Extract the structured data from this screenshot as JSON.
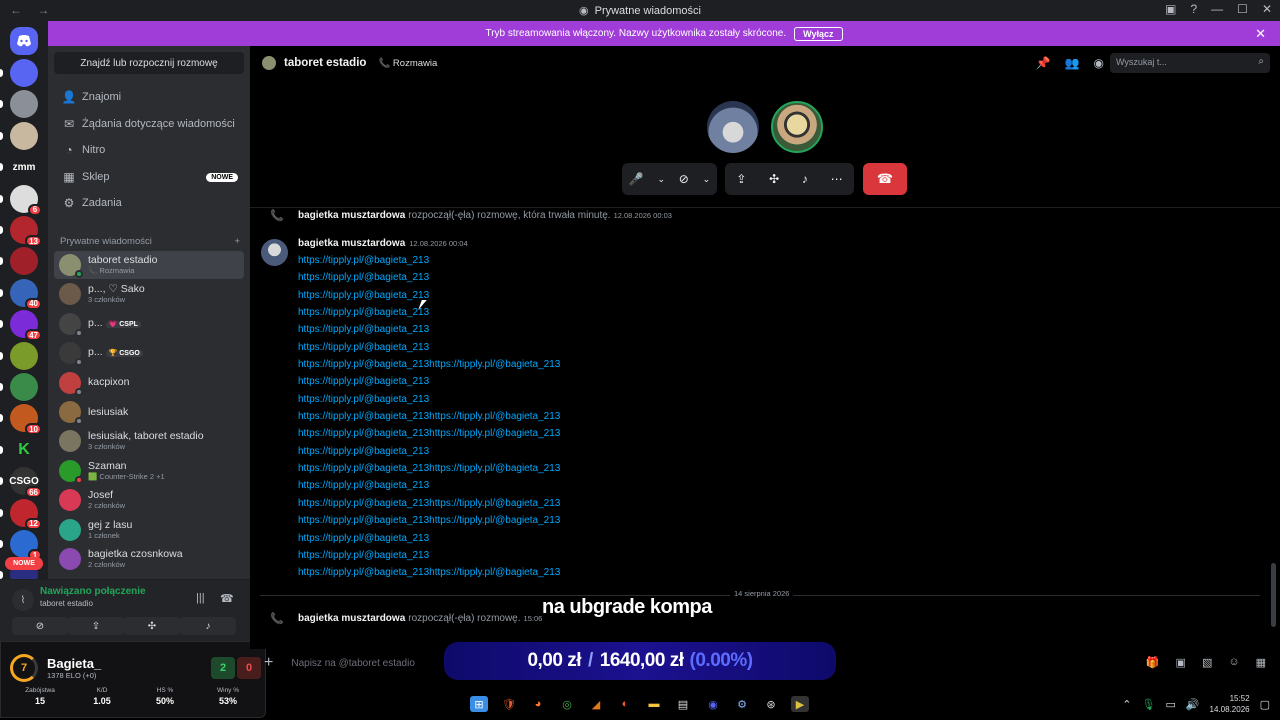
{
  "window": {
    "title": "Prywatne wiadomości",
    "nav_icons": "back-forward-icon",
    "controls": [
      "inbox-icon",
      "help-icon",
      "minimize-icon",
      "maximize-icon",
      "close-icon"
    ]
  },
  "banner": {
    "text": "Tryb streamowania włączony. Nazwy użytkownika zostały skrócone.",
    "button": "Wyłącz"
  },
  "guilds": [
    {
      "abbr": "",
      "color": "#5865f2",
      "badge": ""
    },
    {
      "abbr": "",
      "color": "#8a8f98",
      "badge": ""
    },
    {
      "abbr": "",
      "color": "#c9b8a0",
      "badge": ""
    },
    {
      "abbr": "zmm",
      "color": "#1e1f22",
      "badge": ""
    },
    {
      "abbr": "",
      "color": "#ddd",
      "badge": "6"
    },
    {
      "abbr": "",
      "color": "#b3262d",
      "badge": "13"
    },
    {
      "abbr": "",
      "color": "#a0202a",
      "badge": ""
    },
    {
      "abbr": "",
      "color": "#3564b8",
      "badge": "40"
    },
    {
      "abbr": "",
      "color": "#7c2bd9",
      "badge": "47"
    },
    {
      "abbr": "",
      "color": "#7a9a2a",
      "badge": ""
    },
    {
      "abbr": "",
      "color": "#3a8a4a",
      "badge": ""
    },
    {
      "abbr": "",
      "color": "#c25a20",
      "badge": "10"
    },
    {
      "abbr": "K",
      "color": "#1e1f22",
      "badge": ""
    },
    {
      "abbr": "CSGO",
      "color": "#333",
      "badge": "66"
    },
    {
      "abbr": "",
      "color": "#c0262d",
      "badge": "12"
    },
    {
      "abbr": "",
      "color": "#2b6ad0",
      "badge": "1"
    },
    {
      "abbr": "",
      "color": "#2a2d80",
      "badge": ""
    }
  ],
  "guild_new": "NOWE",
  "sidebar": {
    "search_button": "Znajdź lub rozpocznij rozmowę",
    "nav": [
      {
        "label": "Znajomi",
        "icon": "friends-icon"
      },
      {
        "label": "Żądania dotyczące wiadomości",
        "icon": "mail-icon"
      },
      {
        "label": "Nitro",
        "icon": "nitro-icon"
      },
      {
        "label": "Sklep",
        "icon": "shop-icon",
        "badge": "NOWE"
      },
      {
        "label": "Zadania",
        "icon": "quests-icon"
      }
    ],
    "dm_header": "Prywatne wiadomości",
    "dms": [
      {
        "name": "taboret estadio",
        "sub": "📞 Rozmawia",
        "color": "#8a8f70",
        "status": "#23a55a",
        "tag": ""
      },
      {
        "name": "p..., ♡ Sako",
        "sub": "3 członków",
        "color": "#6b5a4a",
        "status": "",
        "tag": ""
      },
      {
        "name": "p...",
        "sub": "",
        "color": "#444",
        "status": "#80848e",
        "tag": "💗 CSPL"
      },
      {
        "name": "p...",
        "sub": "",
        "color": "#3a3a3a",
        "status": "#80848e",
        "tag": "🏆 CSGO"
      },
      {
        "name": "kacpixon",
        "sub": "",
        "color": "#c04040",
        "status": "#80848e",
        "tag": ""
      },
      {
        "name": "lesiusiak",
        "sub": "",
        "color": "#8a6a40",
        "status": "#80848e",
        "tag": ""
      },
      {
        "name": "lesiusiak, taboret estadio",
        "sub": "3 członków",
        "color": "#7a7560",
        "status": "",
        "tag": ""
      },
      {
        "name": "Szaman",
        "sub": "🟩 Counter-Strike 2 +1",
        "color": "#2a9a2a",
        "status": "#f23f43",
        "tag": ""
      },
      {
        "name": "Josef",
        "sub": "2 członków",
        "color": "#d83a55",
        "status": "",
        "tag": ""
      },
      {
        "name": "gej z lasu",
        "sub": "1 członek",
        "color": "#2aa58a",
        "status": "",
        "tag": ""
      },
      {
        "name": "bagietka czosnkowa",
        "sub": "2 członków",
        "color": "#8a4ab0",
        "status": "",
        "tag": ""
      }
    ]
  },
  "voice": {
    "status": "Nawiązano połączenie",
    "channel": "taboret estadio"
  },
  "elo": {
    "level": "7",
    "nick": "Bagieta_",
    "elo": "1378 ELO (+0)",
    "wins": "2",
    "losses": "0",
    "stats": [
      {
        "label": "Zabójstwa",
        "value": "15"
      },
      {
        "label": "K/D",
        "value": "1.05"
      },
      {
        "label": "HS %",
        "value": "50%"
      },
      {
        "label": "Winy %",
        "value": "53%"
      }
    ]
  },
  "header": {
    "title": "taboret estadio",
    "talking": "Rozmawia",
    "search_placeholder": "Wyszukaj t..."
  },
  "chat": {
    "call1": {
      "author": "bagietka musztardowa",
      "text": "rozpoczął(-ęła) rozmowę, która trwała minutę.",
      "time": "12.08.2026 00:03"
    },
    "msg": {
      "author": "bagietka musztardowa",
      "time": "12.08.2026 00:04",
      "links": [
        "https://tipply.pl/@bagieta_213",
        "https://tipply.pl/@bagieta_213",
        "https://tipply.pl/@bagieta_213",
        "https://tipply.pl/@bagieta_213",
        "https://tipply.pl/@bagieta_213",
        "https://tipply.pl/@bagieta_213",
        "https://tipply.pl/@bagieta_213https://tipply.pl/@bagieta_213",
        "https://tipply.pl/@bagieta_213",
        "https://tipply.pl/@bagieta_213",
        "https://tipply.pl/@bagieta_213https://tipply.pl/@bagieta_213",
        "https://tipply.pl/@bagieta_213https://tipply.pl/@bagieta_213",
        "https://tipply.pl/@bagieta_213",
        "https://tipply.pl/@bagieta_213https://tipply.pl/@bagieta_213",
        "https://tipply.pl/@bagieta_213",
        "https://tipply.pl/@bagieta_213https://tipply.pl/@bagieta_213",
        "https://tipply.pl/@bagieta_213https://tipply.pl/@bagieta_213",
        "https://tipply.pl/@bagieta_213",
        "https://tipply.pl/@bagieta_213",
        "https://tipply.pl/@bagieta_213https://tipply.pl/@bagieta_213"
      ]
    },
    "day_divider": "14 sierpnia 2026",
    "call2": {
      "author": "bagietka musztardowa",
      "text": "rozpoczął(-ęła) rozmowę.",
      "time": "15:06"
    }
  },
  "input_placeholder": "Napisz na @taboret estadio",
  "overlay": {
    "subtitle": "na ubgrade kompa",
    "amount": "0,00 zł",
    "sep": "/",
    "goal": "1640,00 zł",
    "percent": "(0.00%)",
    "progress": 0.0
  },
  "taskbar": {
    "time": "15:52",
    "date": "14.08.2026"
  }
}
